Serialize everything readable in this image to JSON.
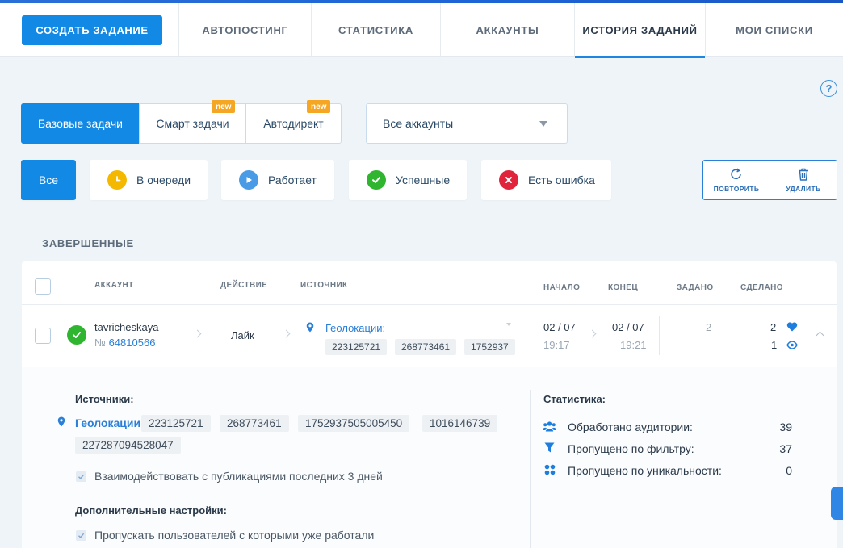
{
  "nav": {
    "create_label": "СОЗДАТЬ ЗАДАНИЕ",
    "tabs": [
      "АВТОПОСТИНГ",
      "СТАТИСТИКА",
      "АККАУНТЫ",
      "ИСТОРИЯ ЗАДАНИЙ",
      "МОИ СПИСКИ"
    ],
    "active_tab": "ИСТОРИЯ ЗАДАНИЙ"
  },
  "help_label": "?",
  "task_types": [
    {
      "label": "Базовые задачи",
      "active": true,
      "badge": ""
    },
    {
      "label": "Смарт задачи",
      "active": false,
      "badge": "new"
    },
    {
      "label": "Автодирект",
      "active": false,
      "badge": "new"
    }
  ],
  "account_select": {
    "value": "Все аккаунты"
  },
  "status_filters": [
    {
      "label": "Все",
      "active": true,
      "icon": ""
    },
    {
      "label": "В очереди",
      "icon": "clock-icon",
      "color": "#f5b800"
    },
    {
      "label": "Работает",
      "icon": "play-icon",
      "color": "#4a9be6"
    },
    {
      "label": "Успешные",
      "icon": "check-icon",
      "color": "#2fb52f"
    },
    {
      "label": "Есть ошибка",
      "icon": "x-icon",
      "color": "#e0243c"
    }
  ],
  "actions": {
    "repeat_label": "ПОВТОРИТЬ",
    "delete_label": "УДАЛИТЬ"
  },
  "section_title": "ЗАВЕРШЕННЫЕ",
  "table": {
    "headers": {
      "account": "АККАУНТ",
      "action": "ДЕЙСТВИЕ",
      "source": "ИСТОЧНИК",
      "start": "НАЧАЛО",
      "end": "КОНЕЦ",
      "assigned": "ЗАДАНО",
      "done": "СДЕЛАНО"
    },
    "row": {
      "username": "tavricheskaya",
      "number_prefix": "№",
      "number": "64810566",
      "action": "Лайк",
      "source_label": "Геолокации:",
      "source_chips": [
        "223125721",
        "268773461",
        "1752937"
      ],
      "start_date": "02 / 07",
      "start_time": "19:17",
      "end_date": "02 / 07",
      "end_time": "19:21",
      "assigned": "2",
      "done_likes": "2",
      "done_views": "1"
    }
  },
  "detail": {
    "sources_title": "Источники:",
    "geo_label": "Геолокации:",
    "geo_ids": [
      "223125721",
      "268773461",
      "1752937505005450",
      "1016146739",
      "227287094528047"
    ],
    "option_recent": "Взаимодействовать с публикациями последних 3 дней",
    "extra_title": "Дополнительные настройки:",
    "option_skip": "Пропускать пользователей с которыми уже работали",
    "stats_title": "Статистика:",
    "stats": [
      {
        "label": "Обработано аудитории:",
        "value": "39",
        "icon": "users-icon"
      },
      {
        "label": "Пропущено по фильтру:",
        "value": "37",
        "icon": "filter-icon"
      },
      {
        "label": "Пропущено по уникальности:",
        "value": "0",
        "icon": "unique-icon"
      }
    ]
  },
  "colors": {
    "accent": "#1189e5",
    "success": "#2fb52f",
    "warning": "#f5b800",
    "error": "#e0243c",
    "badge": "#f5a623"
  }
}
